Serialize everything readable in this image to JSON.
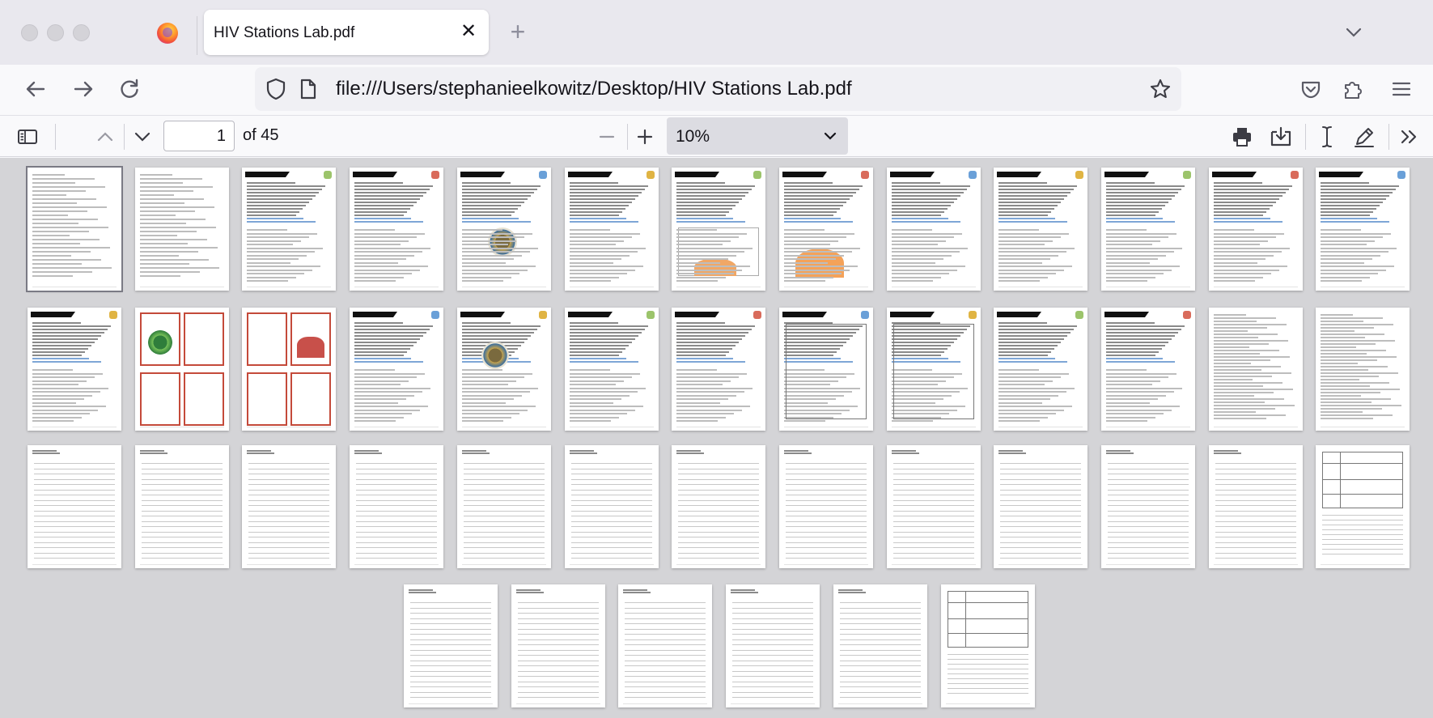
{
  "tab": {
    "title": "HIV Stations Lab.pdf",
    "close": "✕",
    "new": "+"
  },
  "url": {
    "value": "file:///Users/stephanieelkowitz/Desktop/HIV Stations Lab.pdf"
  },
  "pdf": {
    "page_value": "1",
    "page_total": "of 45",
    "zoom": "10%"
  },
  "colors": {
    "accent_card": "#c44a3a",
    "toolbar_bg": "#f9f9fb",
    "viewer_bg": "#d4d4d7"
  },
  "icons": {
    "back": "arrow-left-icon",
    "forward": "arrow-right-icon",
    "reload": "reload-icon",
    "shield": "shield-icon",
    "page": "page-icon",
    "star": "star-icon",
    "pocket": "pocket-icon",
    "extensions": "puzzle-icon",
    "menu": "hamburger-icon",
    "sidebar": "sidebar-toggle-icon",
    "prev": "chevron-up-icon",
    "next": "chevron-down-icon",
    "zoom_out": "minus-icon",
    "zoom_in": "plus-icon",
    "print": "printer-icon",
    "save": "download-icon",
    "text": "text-cursor-icon",
    "draw": "pen-icon",
    "more": "chevrons-right-icon"
  }
}
